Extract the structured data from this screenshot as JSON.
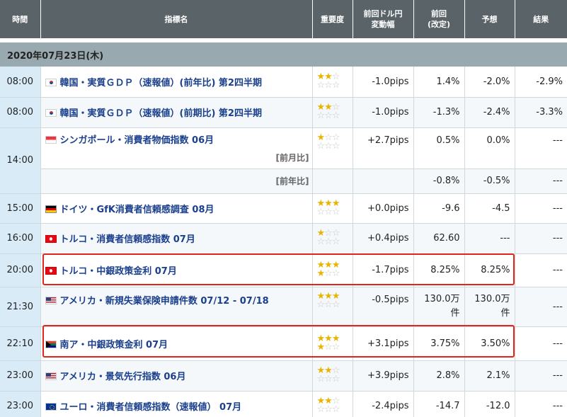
{
  "headers": {
    "time": "時間",
    "indicator": "指標名",
    "importance": "重要度",
    "prev_usdjpy": "前回ドル円\n変動幅",
    "prev_revised": "前回\n(改定)",
    "forecast": "予想",
    "result": "結果"
  },
  "date_label": "2020年07月23日(木)",
  "colors": {
    "header_bg": "#5a6368",
    "date_bar_bg": "#98aab0",
    "time_bg": "#d9ebf7",
    "name_color": "#1a3f8c",
    "star_on": "#e8b400",
    "highlight": "#e3241b"
  },
  "rows": [
    {
      "time": "08:00",
      "flag": "kr-flag-icon",
      "name": "韓国・実質ＧＤＰ（速報値）(前年比) 第2四半期",
      "stars": 2,
      "pips": "-1.0pips",
      "prev": "1.4%",
      "forecast": "-2.0%",
      "result": "-2.9%"
    },
    {
      "time": "08:00",
      "flag": "kr-flag-icon",
      "name": "韓国・実質ＧＤＰ（速報値）(前期比) 第2四半期",
      "stars": 2,
      "pips": "-1.0pips",
      "prev": "-1.3%",
      "forecast": "-2.4%",
      "result": "-3.3%"
    },
    {
      "time": "14:00",
      "flag": "sg-flag-icon",
      "name": "シンガポール・消費者物価指数 06月",
      "sub": "[前月比]",
      "stars": 1,
      "pips": "+2.7pips",
      "prev": "0.5%",
      "forecast": "0.0%",
      "result": "---"
    },
    {
      "sub": "[前年比]",
      "prev": "-0.8%",
      "forecast": "-0.5%",
      "result": "---"
    },
    {
      "time": "15:00",
      "flag": "de-flag-icon",
      "name": "ドイツ・GfK消費者信頼感調査 08月",
      "stars": 3,
      "pips": "+0.0pips",
      "prev": "-9.6",
      "forecast": "-4.5",
      "result": "---"
    },
    {
      "time": "16:00",
      "flag": "tr-flag-icon",
      "name": "トルコ・消費者信頼感指数 07月",
      "stars": 1,
      "pips": "+0.4pips",
      "prev": "62.60",
      "forecast": "---",
      "result": "---"
    },
    {
      "time": "20:00",
      "flag": "tr-flag-icon",
      "name": "トルコ・中銀政策金利 07月",
      "stars": 4,
      "pips": "-1.7pips",
      "prev": "8.25%",
      "forecast": "8.25%",
      "result": "---"
    },
    {
      "time": "21:30",
      "flag": "us-flag-icon",
      "name": "アメリカ・新規失業保険申請件数 07/12 - 07/18",
      "stars": 3,
      "pips": "-0.5pips",
      "prev": "130.0万\n件",
      "forecast": "130.0万\n件",
      "result": "---"
    },
    {
      "time": "22:10",
      "flag": "za-flag-icon",
      "name": "南ア・中銀政策金利 07月",
      "stars": 4,
      "pips": "+3.1pips",
      "prev": "3.75%",
      "forecast": "3.50%",
      "result": "---"
    },
    {
      "time": "23:00",
      "flag": "us-flag-icon",
      "name": "アメリカ・景気先行指数 06月",
      "stars": 2,
      "pips": "+3.9pips",
      "prev": "2.8%",
      "forecast": "2.1%",
      "result": "---"
    },
    {
      "time": "23:00",
      "flag": "eu-flag-icon",
      "name": "ユーロ・消費者信頼感指数（速報値） 07月",
      "stars": 2,
      "pips": "-2.4pips",
      "prev": "-14.7",
      "forecast": "-12.0",
      "result": "---"
    }
  ]
}
